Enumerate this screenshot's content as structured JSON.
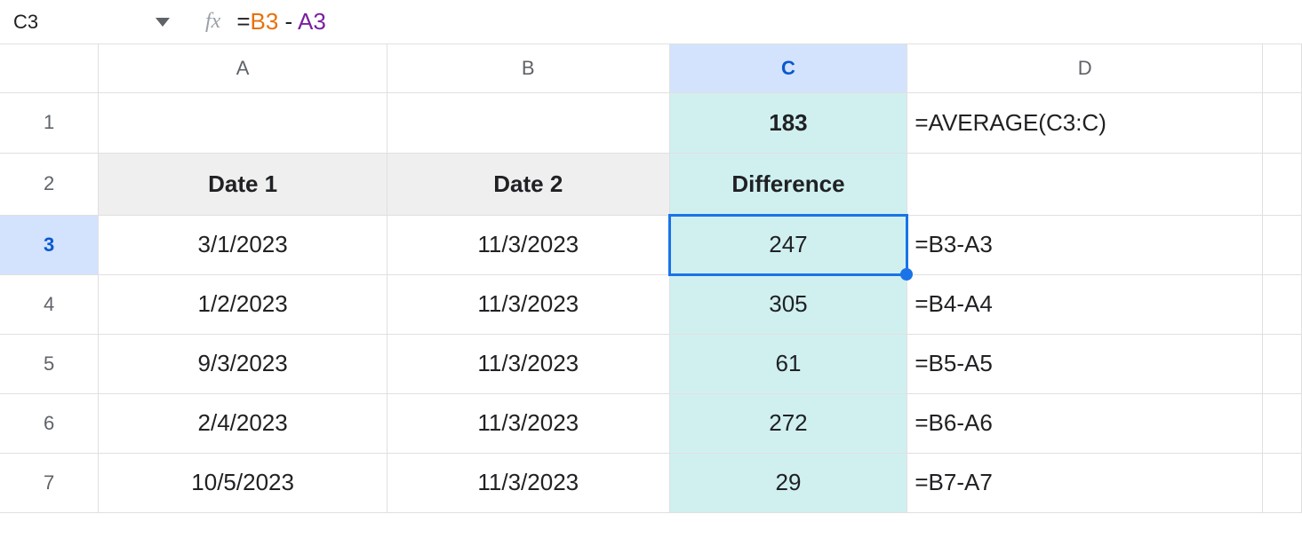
{
  "nameBox": "C3",
  "formula": {
    "prefix": "=",
    "ref1": "B3",
    "op": " - ",
    "ref2": "A3"
  },
  "columns": [
    "A",
    "B",
    "C",
    "D"
  ],
  "rows": [
    "1",
    "2",
    "3",
    "4",
    "5",
    "6",
    "7"
  ],
  "selectedCol": "C",
  "selectedRow": "3",
  "cells": {
    "C1": "183",
    "D1": "=AVERAGE(C3:C)",
    "A2": "Date 1",
    "B2": "Date 2",
    "C2": "Difference",
    "A3": "3/1/2023",
    "B3": "11/3/2023",
    "C3": "247",
    "D3": "=B3-A3",
    "A4": "1/2/2023",
    "B4": "11/3/2023",
    "C4": "305",
    "D4": "=B4-A4",
    "A5": "9/3/2023",
    "B5": "11/3/2023",
    "C5": "61",
    "D5": "=B5-A5",
    "A6": "2/4/2023",
    "B6": "11/3/2023",
    "C6": "272",
    "D6": "=B6-A6",
    "A7": "10/5/2023",
    "B7": "11/3/2023",
    "C7": "29",
    "D7": "=B7-A7"
  }
}
